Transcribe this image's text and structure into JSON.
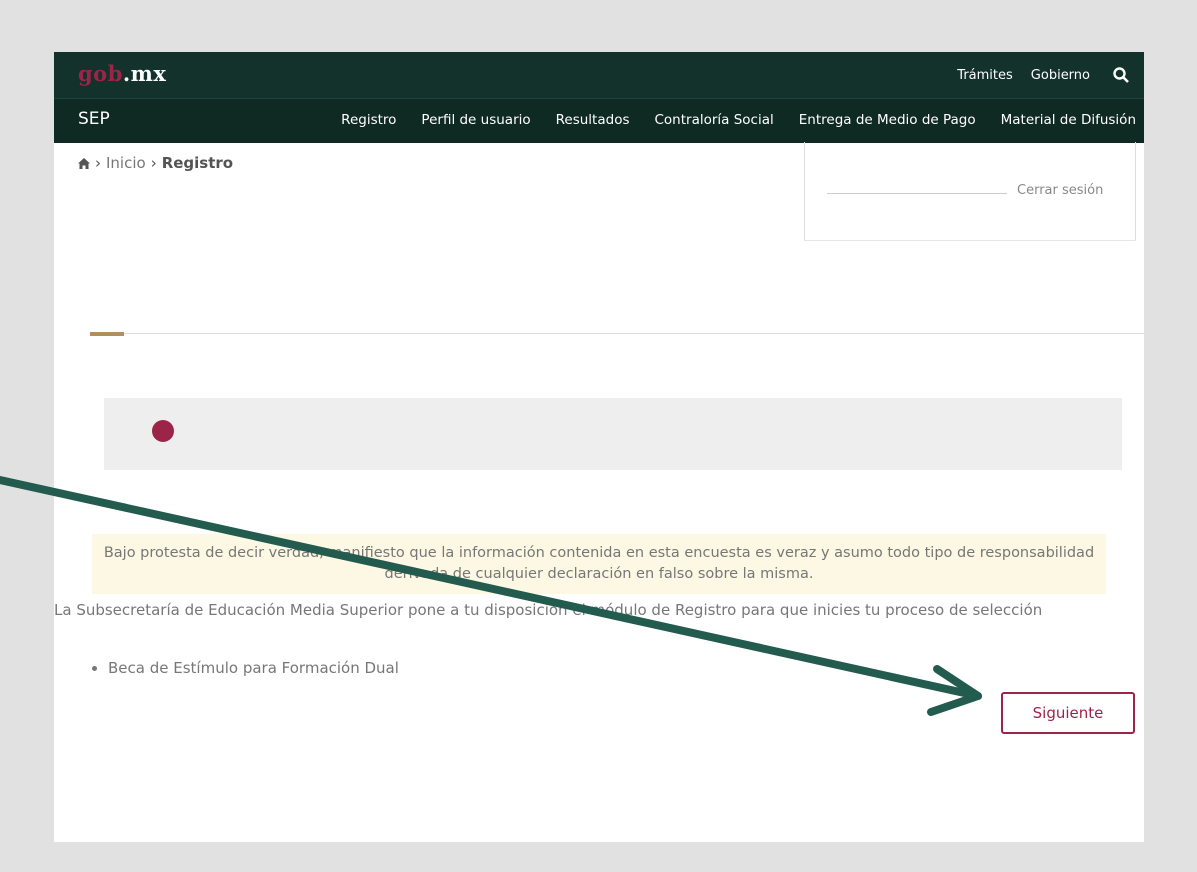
{
  "header": {
    "logo_gob": "gob",
    "logo_mx": ".mx",
    "links": [
      "Trámites",
      "Gobierno"
    ],
    "search_icon": "search-icon"
  },
  "subnav": {
    "brand": "SEP",
    "items": [
      "Registro",
      "Perfil de usuario",
      "Resultados",
      "Contraloría Social",
      "Entrega de Medio de Pago",
      "Material de Difusión"
    ]
  },
  "breadcrumb": {
    "home_icon": "home-icon",
    "items": [
      "Inicio",
      "Registro"
    ]
  },
  "session": {
    "logout_label": "Cerrar sesión"
  },
  "notice": "Bajo protesta de decir verdad, manifiesto que la información contenida en esta encuesta es veraz y asumo todo tipo de responsabilidad derivada de cualquier declaración en falso sobre la misma.",
  "intro": "La Subsecretaría de Educación Media Superior pone a tu disposición el módulo de Registro para que inicies tu proceso de selección",
  "programs": [
    "Beca de Estímulo para Formación Dual"
  ],
  "next_button": "Siguiente",
  "colors": {
    "dark_green": "#13322b",
    "guinda": "#9d2449",
    "gold": "#b38e5d",
    "arrow": "#235b4e"
  }
}
